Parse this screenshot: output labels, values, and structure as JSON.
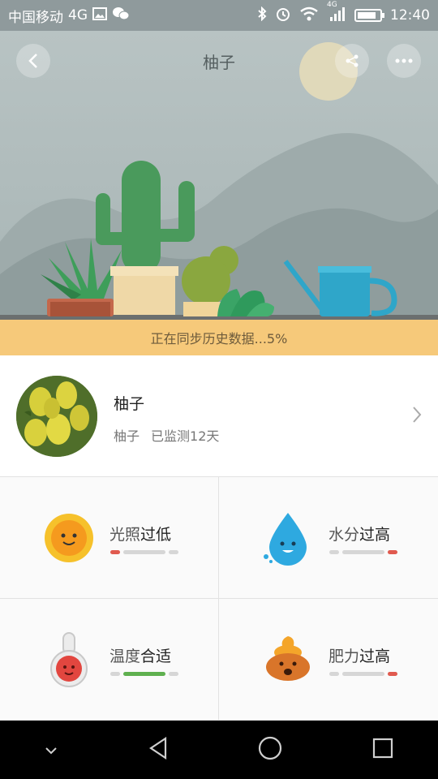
{
  "status_bar": {
    "carrier": "中国移动",
    "network": "4G",
    "signal_label": "4G",
    "time": "12:40",
    "battery_level": 0.85
  },
  "header": {
    "title": "柚子",
    "back_icon": "chevron-left-icon",
    "share_icon": "share-icon",
    "more_icon": "more-icon"
  },
  "sync_banner": {
    "text": "正在同步历史数据...5%"
  },
  "plant": {
    "name": "柚子",
    "species": "柚子",
    "monitored": "已监测12天"
  },
  "metrics": [
    {
      "key": "光照",
      "status": "过低",
      "icon": "sun-icon",
      "level": 0.05,
      "level_color": "#e05a4f"
    },
    {
      "key": "水分",
      "status": "过高",
      "icon": "water-drop-icon",
      "level": 0.95,
      "level_color": "#e05a4f"
    },
    {
      "key": "温度",
      "status": "合适",
      "icon": "thermometer-icon",
      "level": 0.5,
      "level_color": "#5fb04f"
    },
    {
      "key": "肥力",
      "status": "过高",
      "icon": "fertilizer-icon",
      "level": 0.95,
      "level_color": "#e05a4f"
    }
  ],
  "nav": {
    "down_icon": "chevron-down-icon",
    "back_icon": "triangle-back-icon",
    "home_icon": "circle-home-icon",
    "recents_icon": "square-recents-icon"
  },
  "colors": {
    "banner": "#f6c97a",
    "hero_bg": "#c3cdcd",
    "alert": "#e05a4f",
    "ok": "#5fb04f"
  }
}
